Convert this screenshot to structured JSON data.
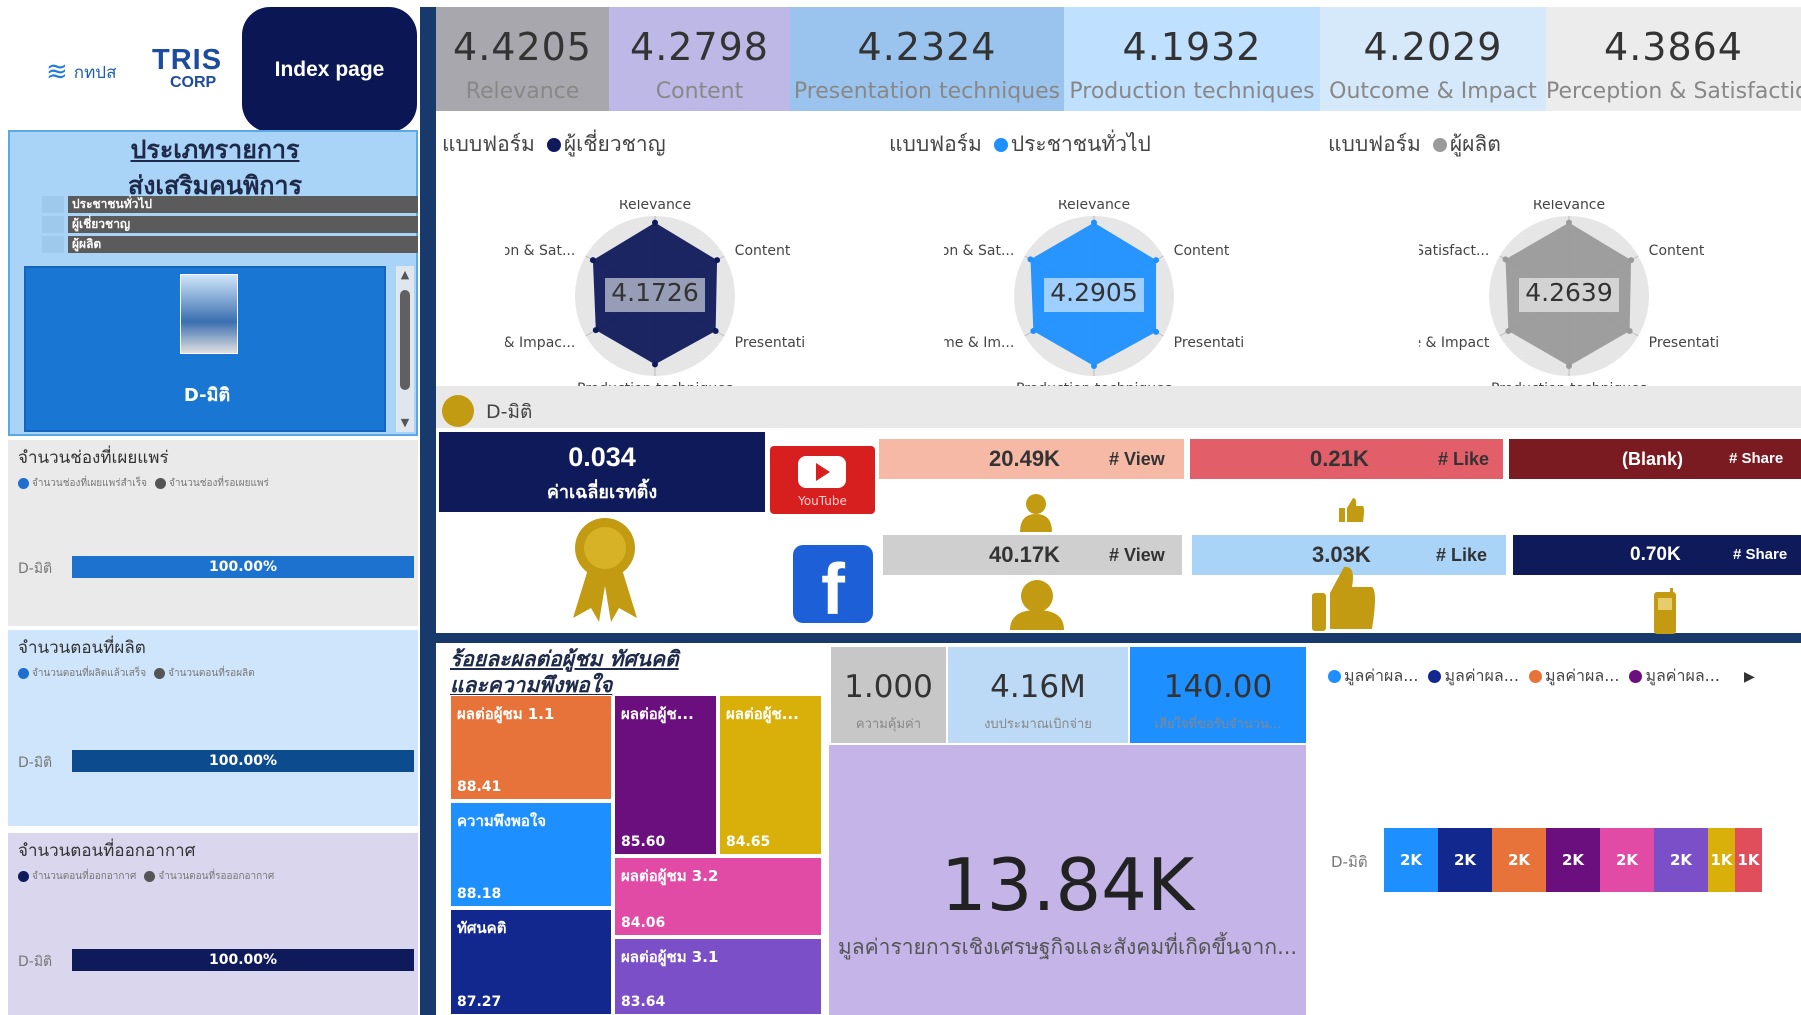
{
  "header": {
    "govt_logo_text": "กทปส",
    "tris_logo_line1": "TRIS",
    "tris_logo_line2": "CORP",
    "index_button": "Index page"
  },
  "category_filter": {
    "title_line1": "ประเภทรายการ",
    "title_line2": "ส่งเสริมคนพิการ",
    "items": [
      "ประชาชนทั่วไป",
      "ผู้เชี่ยวชาญ",
      "ผู้ผลิต"
    ],
    "selected_program": "D-มิติ"
  },
  "left_metrics": [
    {
      "title": "จำนวนช่องที่เผยแพร่",
      "legend": [
        "จำนวนช่องที่เผยแพร่สำเร็จ",
        "จำนวนช่องที่รอเผยแพร่"
      ],
      "legend_colors": [
        "#1e6fd0",
        "#555555"
      ],
      "row_label": "D-มิติ",
      "value": "100.00%",
      "bar_color": "#1d72d0",
      "bg": "#eaeaea"
    },
    {
      "title": "จำนวนตอนที่ผลิต",
      "legend": [
        "จำนวนตอนที่ผลิตแล้วเสร็จ",
        "จำนวนตอนที่รอผลิต"
      ],
      "legend_colors": [
        "#1e6fd0",
        "#555555"
      ],
      "row_label": "D-มิติ",
      "value": "100.00%",
      "bar_color": "#0d4b8f",
      "bg": "#cfe5fb"
    },
    {
      "title": "จำนวนตอนที่ออกอากาศ",
      "legend": [
        "จำนวนตอนที่ออกอากาศ",
        "จำนวนตอนที่รอออกอากาศ"
      ],
      "legend_colors": [
        "#0f1a5a",
        "#555555"
      ],
      "row_label": "D-มิติ",
      "value": "100.00%",
      "bar_color": "#0f1a5a",
      "bg": "#d9d6ee"
    }
  ],
  "kpis": [
    {
      "value": "4.4205",
      "label": "Relevance",
      "bg": "#a7a7ad"
    },
    {
      "value": "4.2798",
      "label": "Content",
      "bg": "#bdb8e6"
    },
    {
      "value": "4.2324",
      "label": "Presentation techniques",
      "bg": "#9ac4ee"
    },
    {
      "value": "4.1932",
      "label": "Production techniques",
      "bg": "#bfe0ff"
    },
    {
      "value": "4.2029",
      "label": "Outcome & Impact",
      "bg": "#d6e9fb"
    },
    {
      "value": "4.3864",
      "label": "Perception & Satisfaction",
      "bg": "#ececec"
    }
  ],
  "radars": [
    {
      "legend_prefix": "แบบฟอร์ม",
      "legend_item": "ผู้เชี่ยวชาญ",
      "legend_color": "#0f1a5a",
      "fill": "#0f1a5a",
      "center_value": "4.1726",
      "axes": [
        "Relevance",
        "Content",
        "Presentation tec...",
        "Production techniques",
        "Outcome & Impac...",
        "Perception & Sat..."
      ],
      "values": [
        4.4,
        4.3,
        4.2,
        4.1,
        4.1,
        4.3
      ]
    },
    {
      "legend_prefix": "แบบฟอร์ม",
      "legend_item": "ประชาชนทั่วไป",
      "legend_color": "#1e8fff",
      "fill": "#1e8fff",
      "center_value": "4.2905",
      "axes": [
        "Relevance",
        "Content",
        "Presentation tec...",
        "Production techniques",
        "Outcome & Im...",
        "Perception & Sat..."
      ],
      "values": [
        4.4,
        4.3,
        4.3,
        4.2,
        4.2,
        4.4
      ]
    },
    {
      "legend_prefix": "แบบฟอร์ม",
      "legend_item": "ผู้ผลิต",
      "legend_color": "#9a9a9a",
      "fill": "#9a9a9a",
      "center_value": "4.2639",
      "axes": [
        "Relevance",
        "Content",
        "Presentation techni...",
        "Production techniques",
        "Outcome & Impact",
        "Perception & Satisfact..."
      ],
      "values": [
        4.4,
        4.3,
        4.2,
        4.2,
        4.2,
        4.4
      ]
    }
  ],
  "program_strip": {
    "label": "D-มิติ"
  },
  "average": {
    "value": "0.034",
    "label": "ค่าเฉลี่ยเรทติ้ง"
  },
  "youtube": {
    "logo_text": "YouTube",
    "views": "20.49K",
    "views_label": "# View",
    "likes": "0.21K",
    "likes_label": "# Like",
    "shares": "(Blank)",
    "shares_label": "# Share"
  },
  "facebook": {
    "logo_text": "f",
    "views": "40.17K",
    "views_label": "# View",
    "likes": "3.03K",
    "likes_label": "# Like",
    "shares": "0.70K",
    "shares_label": "# Share"
  },
  "treemap": {
    "title_line1": "ร้อยละผลต่อผู้ชม ทัศนคติ",
    "title_line2": "และความพึงพอใจ",
    "cells": [
      {
        "label": "ผลต่อผู้ชม 1.1",
        "value": "88.41",
        "color": "#e8733a"
      },
      {
        "label": "ผลต่อผู้ช...",
        "value": "85.60",
        "color": "#6a0f7d"
      },
      {
        "label": "ผลต่อผู้ช...",
        "value": "84.65",
        "color": "#d9b00a"
      },
      {
        "label": "ความพึงพอใจ",
        "value": "88.18",
        "color": "#1e8fff"
      },
      {
        "label": "ผลต่อผู้ชม 3.2",
        "value": "84.06",
        "color": "#e14ba6"
      },
      {
        "label": "ทัศนคติ",
        "value": "87.27",
        "color": "#12288f"
      },
      {
        "label": "ผลต่อผู้ชม 3.1",
        "value": "83.64",
        "color": "#7b4fc7"
      }
    ]
  },
  "kpi2": [
    {
      "value": "1.000",
      "label": "ความคุ้มค่า",
      "bg": "#c7c7c7"
    },
    {
      "value": "4.16M",
      "label": "งบประมาณเบิกจ่าย",
      "bg": "#bcd9f5"
    },
    {
      "value": "140.00",
      "label": "เสียใจที่ขอรับจำนวน...",
      "bg": "#1e8fff"
    }
  ],
  "big_value": {
    "value": "13.84K",
    "label": "มูลค่ารายการเชิงเศรษฐกิจและสังคมที่เกิดขึ้นจาก..."
  },
  "stack": {
    "legend": [
      "มูลค่าผล...",
      "มูลค่าผล...",
      "มูลค่าผล...",
      "มูลค่าผล..."
    ],
    "legend_colors": [
      "#1e8fff",
      "#12288f",
      "#e8733a",
      "#6a0f7d"
    ],
    "more_icon": "chevron-right-icon",
    "row_label": "D-มิติ",
    "segments": [
      {
        "label": "2K",
        "value": 2,
        "color": "#1e8fff"
      },
      {
        "label": "2K",
        "value": 2,
        "color": "#12288f"
      },
      {
        "label": "2K",
        "value": 2,
        "color": "#e8733a"
      },
      {
        "label": "2K",
        "value": 2,
        "color": "#6a0f7d"
      },
      {
        "label": "2K",
        "value": 2,
        "color": "#e14ba6"
      },
      {
        "label": "2K",
        "value": 2,
        "color": "#7b4fc7"
      },
      {
        "label": "1K",
        "value": 1,
        "color": "#d9b00a"
      },
      {
        "label": "1K",
        "value": 1,
        "color": "#e04e5c"
      }
    ]
  }
}
